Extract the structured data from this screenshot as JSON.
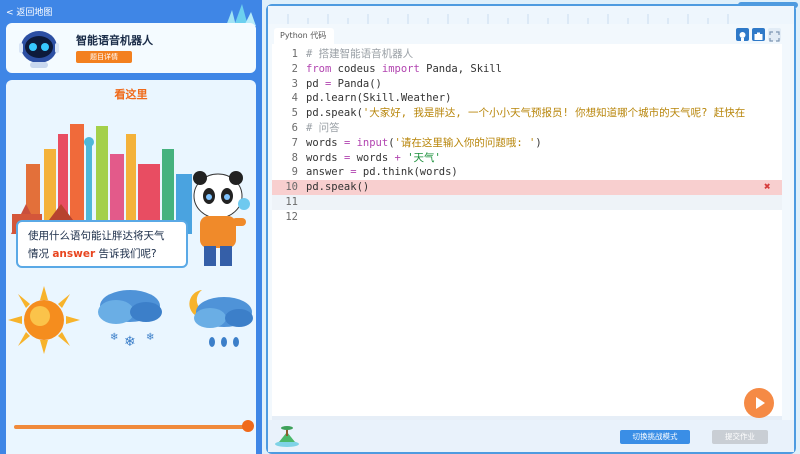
{
  "nav": {
    "back_label": "< 返回地图"
  },
  "robot_card": {
    "title": "智能语音机器人",
    "detail_button": "题目详情"
  },
  "lesson": {
    "heading": "看这里",
    "question_prefix": "使用什么语句能让胖达将天气",
    "question_mid": "情况 ",
    "question_keyword": "answer",
    "question_suffix": " 告诉我们呢?"
  },
  "editor": {
    "tab_label": "Python 代码",
    "lines": [
      {
        "n": "1",
        "code": "# 搭建智能语音机器人"
      },
      {
        "n": "2",
        "code": "from codeus import Panda, Skill"
      },
      {
        "n": "3",
        "code": "pd = Panda()"
      },
      {
        "n": "4",
        "code": "pd.learn(Skill.Weather)"
      },
      {
        "n": "5",
        "code": "pd.speak('大家好, 我是胖达, 一个小小天气预报员! 你想知道哪个城市的天气呢? 赶快在"
      },
      {
        "n": "6",
        "code": "# 问答"
      },
      {
        "n": "7",
        "code": "words = input('请在这里输入你的问题哦: ')"
      },
      {
        "n": "8",
        "code": "words = words + '天气'"
      },
      {
        "n": "9",
        "code": "answer = pd.think(words)"
      },
      {
        "n": "10",
        "code": "pd.speak()"
      },
      {
        "n": "11",
        "code": ""
      },
      {
        "n": "12",
        "code": ""
      }
    ]
  },
  "footer": {
    "switch_button": "切换挑战模式",
    "submit_button": "提交作业"
  },
  "colors": {
    "accent": "#3f86e6",
    "orange": "#f06a1a",
    "error_row": "#f8cfcf"
  }
}
